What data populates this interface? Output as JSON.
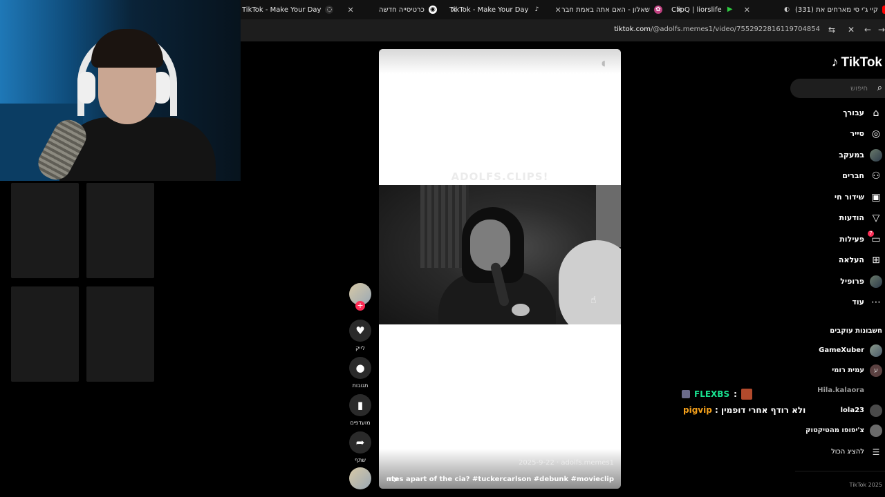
{
  "browser": {
    "tabs": [
      {
        "title": "TikTok - Make Your Day"
      },
      {
        "title": "כרטיסייה חדשה"
      },
      {
        "title": "TikTok - Make Your Day"
      },
      {
        "title": "שאלון - האם אתה באמת חבר"
      },
      {
        "title": "ClipQ | liorslife"
      },
      {
        "title": "(331) קיי ג'י סי מארחים את"
      }
    ],
    "url_domain": "tiktok.com",
    "url_path": "/@adolfs.memes1/video/7552922816119704854"
  },
  "video": {
    "watermark": "ADOLFS.CLIPS!",
    "meta": "2025-9-22 · adolfs.memes1",
    "caption": "nick fuentes apart of the cia? #tuckercarlson #debunk #movieclip ...",
    "more_label": "עוד"
  },
  "actions": {
    "like": {
      "label": "לייק",
      "icon": "heart-icon"
    },
    "comments": {
      "label": "תגובות",
      "icon": "comment-icon"
    },
    "favorites": {
      "label": "מועדפים",
      "icon": "bookmark-icon"
    },
    "share": {
      "label": "שתף",
      "icon": "share-icon"
    }
  },
  "chat": [
    {
      "name": "FLEXBS",
      "text": ":"
    },
    {
      "name": "pigvip",
      "text": ": ולא רודף אחרי דופמין"
    }
  ],
  "sidebar": {
    "logo": "TikTok",
    "search_placeholder": "חיפוש",
    "items": [
      {
        "label": "עבורך",
        "icon": "home-icon"
      },
      {
        "label": "סייר",
        "icon": "compass-icon"
      },
      {
        "label": "במעקב",
        "icon": "avatar-icon"
      },
      {
        "label": "חברים",
        "icon": "friends-icon"
      },
      {
        "label": "שידור חי",
        "icon": "live-icon"
      },
      {
        "label": "הודעות",
        "icon": "send-icon"
      },
      {
        "label": "פעילות",
        "icon": "activity-icon",
        "badge": "7"
      },
      {
        "label": "העלאה",
        "icon": "upload-icon"
      },
      {
        "label": "פרופיל",
        "icon": "profile-icon"
      },
      {
        "label": "עוד",
        "icon": "more-icon"
      }
    ],
    "following_title": "חשבונות עוקבים",
    "following": [
      {
        "name": "GameXuber",
        "dim": false
      },
      {
        "name": "עמית רומי",
        "dim": false
      },
      {
        "name": "Hila.kalaora",
        "dim": true
      },
      {
        "name": "lola23",
        "dim": false
      },
      {
        "name": "צ'יפופו מהטיקטוק",
        "dim": false
      }
    ],
    "show_all": "להציג הכול",
    "copyright": "TikTok 2025"
  },
  "colors": {
    "accent": "#fe2c55",
    "chat_name_1": "#19e08f",
    "chat_name_2": "#f7a21b"
  }
}
